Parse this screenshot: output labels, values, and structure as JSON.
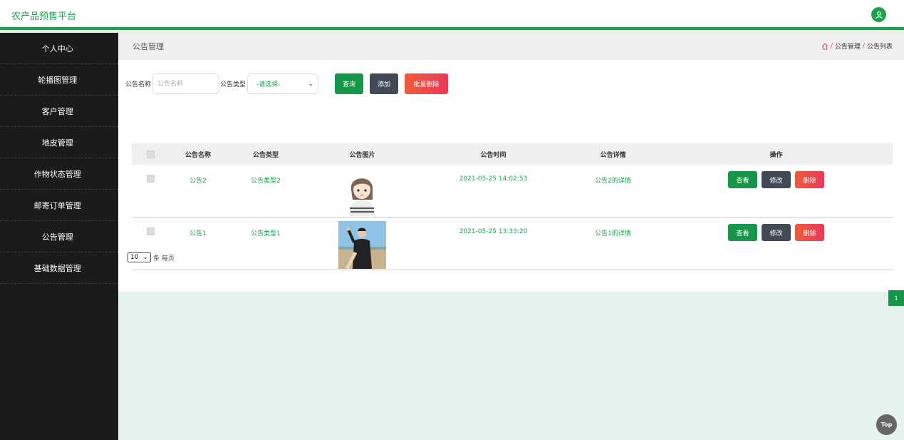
{
  "app": {
    "title": "农产品预售平台",
    "accent": "#1aa34a",
    "icon": "user-icon"
  },
  "sidebar": {
    "items": [
      {
        "label": "个人中心"
      },
      {
        "label": "轮播图管理"
      },
      {
        "label": "客户管理"
      },
      {
        "label": "地皮管理"
      },
      {
        "label": "作物状态管理"
      },
      {
        "label": "邮寄订单管理"
      },
      {
        "label": "公告管理"
      },
      {
        "label": "基础数据管理"
      }
    ]
  },
  "breadcrumb": {
    "title": "公告管理",
    "home_icon": "home-icon",
    "path": [
      "公告管理",
      "公告列表"
    ]
  },
  "search": {
    "name_label": "公告名称",
    "name_placeholder": "公告名称",
    "type_label": "公告类型",
    "type_value": "-请选择-",
    "query_label": "查询",
    "add_label": "添加",
    "batch_delete_label": "批量删除"
  },
  "table": {
    "headers": [
      "公告名称",
      "公告类型",
      "公告图片",
      "公告时间",
      "公告详情",
      "操作"
    ],
    "rows": [
      {
        "name": "公告2",
        "type": "公告类型2",
        "image": "cartoon-girl-image",
        "time": "2021-05-25 14:02:53",
        "detail": "公告2的详情"
      },
      {
        "name": "公告1",
        "type": "公告类型1",
        "image": "person-beach-photo",
        "time": "2021-05-25 13:33:20",
        "detail": "公告1的详情"
      }
    ],
    "actions": {
      "view": "查看",
      "edit": "修改",
      "delete": "删除"
    }
  },
  "pagination": {
    "page_size": "10",
    "page_size_suffix": "条 每页",
    "current_page": "1"
  },
  "back_to_top": "Top"
}
